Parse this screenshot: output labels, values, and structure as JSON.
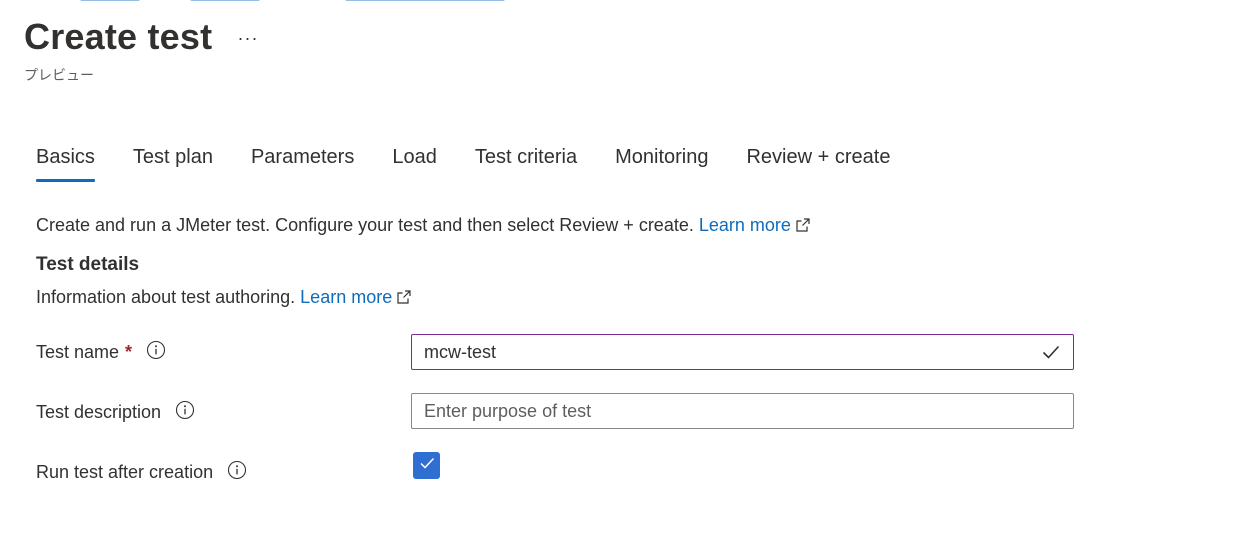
{
  "header": {
    "title": "Create test",
    "more_label": "···",
    "subtitle": "プレビュー"
  },
  "tabs": [
    {
      "label": "Basics",
      "active": true
    },
    {
      "label": "Test plan",
      "active": false
    },
    {
      "label": "Parameters",
      "active": false
    },
    {
      "label": "Load",
      "active": false
    },
    {
      "label": "Test criteria",
      "active": false
    },
    {
      "label": "Monitoring",
      "active": false
    },
    {
      "label": "Review + create",
      "active": false
    }
  ],
  "intro": {
    "text": "Create and run a JMeter test. Configure your test and then select Review + create.",
    "link": "Learn more",
    "link_icon": "external-link-icon"
  },
  "test_details": {
    "title": "Test details",
    "description": "Information about test authoring.",
    "link": "Learn more",
    "link_icon": "external-link-icon"
  },
  "form": {
    "test_name": {
      "label": "Test name",
      "required_marker": "*",
      "info_icon": "info-icon",
      "value": "mcw-test",
      "status_icon": "checkmark-icon"
    },
    "test_description": {
      "label": "Test description",
      "info_icon": "info-icon",
      "value": "",
      "placeholder": "Enter purpose of test"
    },
    "run_after_creation": {
      "label": "Run test after creation",
      "info_icon": "info-icon",
      "checked": true
    }
  },
  "colors": {
    "accent": "#0f6cbd",
    "checkbox": "#2f6fd1",
    "valid_border": "#7a2d8f",
    "required": "#a4262c"
  }
}
